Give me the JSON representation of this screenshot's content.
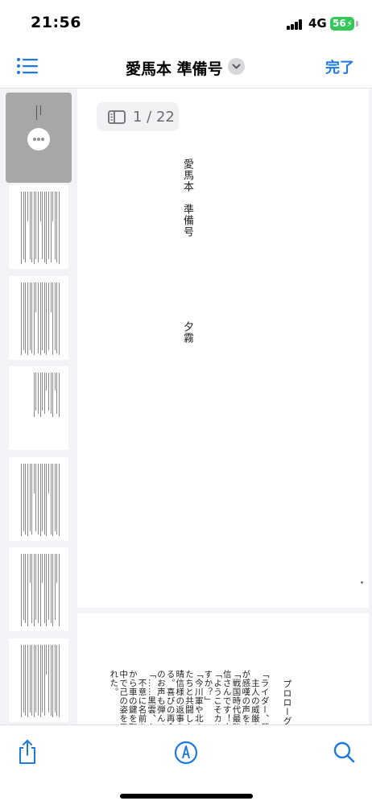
{
  "status_bar": {
    "time": "21:56",
    "network": "4G",
    "battery": "56"
  },
  "nav": {
    "title": "愛馬本 準備号",
    "done_label": "完了",
    "accent_color": "#1f7ae0"
  },
  "page_indicator": {
    "text": "1 / 22"
  },
  "document": {
    "page1": {
      "title": "愛馬本　準備号",
      "author": "夕霧"
    },
    "page2_lines": [
      "プロローグ",
      "",
      "「ライダー、武田",
      "　主人の威厳のあ",
      "が感嘆の声を上げ",
      "「戦国時代最強の",
      "信さんです！大",
      "「ようこそカルデ",
      "すか？」",
      "「今川軍や北の",
      "たちと共闘した",
      "晴信様の返事を",
      "る。喜びの再会",
      "のお声も弾んでい",
      "「……黒雲、お前",
      "　不意に名前を呼",
      "から車の鍵を取",
      "中で己の姿を馬に",
      "れた。"
    ]
  },
  "icons": {
    "thumbnails_list": "list-icon",
    "title_menu": "chevron-down-icon",
    "thumbnail_more": "ellipsis-icon",
    "page_indicator": "sidebar-icon",
    "share": "share-icon",
    "markup": "markup-pen-icon",
    "search": "search-icon"
  }
}
